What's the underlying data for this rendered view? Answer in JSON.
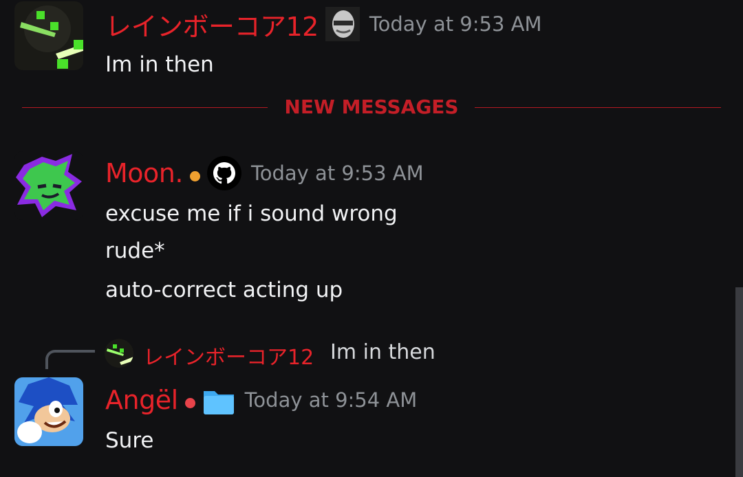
{
  "messages": [
    {
      "username": "レインボーコア12",
      "timestamp": "Today at 9:53 AM",
      "badge_icon": "masked-face-icon",
      "lines": [
        "Im in then"
      ],
      "name_color": "#e8232a"
    },
    {
      "username": "Moon.",
      "timestamp": "Today at 9:53 AM",
      "status_color": "#f0a030",
      "badge_icon": "github-icon",
      "lines": [
        "excuse me if i sound wrong",
        "rude*",
        "auto-correct acting up"
      ],
      "name_color": "#e8232a"
    },
    {
      "username": "Angël",
      "timestamp": "Today at 9:54 AM",
      "status_color": "#e8434a",
      "badge_icon": "folder-icon",
      "lines": [
        "Sure"
      ],
      "name_color": "#e8232a",
      "reply": {
        "username": "レインボーコア12",
        "text": "Im in then"
      }
    }
  ],
  "divider": {
    "label": "NEW MESSAGES",
    "color": "#c41e27"
  }
}
